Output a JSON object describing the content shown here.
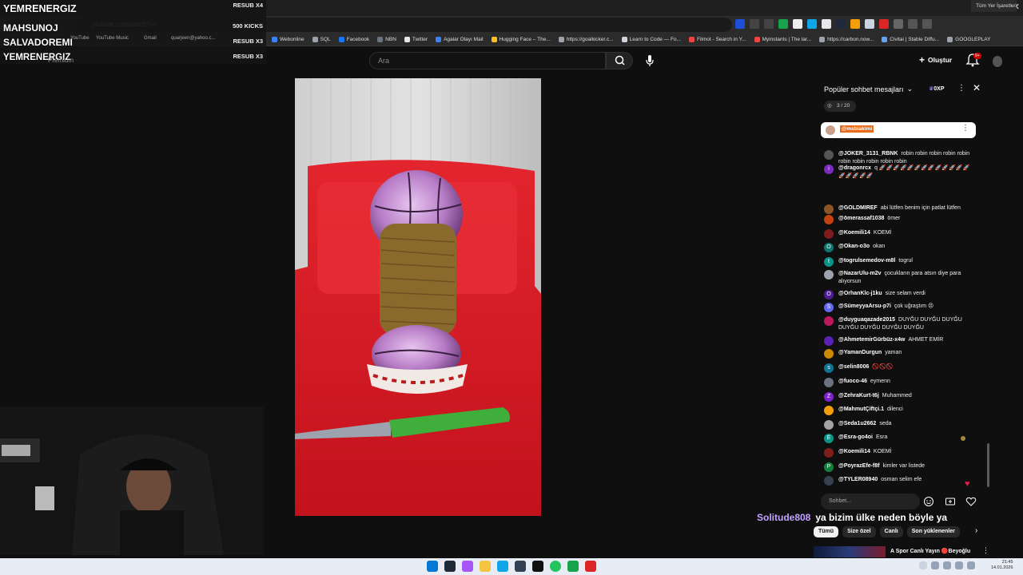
{
  "browser": {
    "url": "youtube.com/watch?v=...",
    "bookmarks": [
      {
        "label": "Webonline",
        "color": "#3b82f6"
      },
      {
        "label": "SQL",
        "color": "#9ca3af"
      },
      {
        "label": "Facebook",
        "color": "#1877f2"
      },
      {
        "label": "NBN",
        "color": "#6b7280"
      },
      {
        "label": "Twitter",
        "color": "#e5e7eb"
      },
      {
        "label": "Agalar Olayı Mail",
        "color": "#3b82f6"
      },
      {
        "label": "Hugging Face – The...",
        "color": "#fbbf24"
      },
      {
        "label": "https://goalkicker.c...",
        "color": "#9ca3af"
      },
      {
        "label": "Learn to Code — Fo...",
        "color": "#d1d5db"
      },
      {
        "label": "Filmot - Search in Y...",
        "color": "#ef4444"
      },
      {
        "label": "Myinstants | The lar...",
        "color": "#ef4444"
      },
      {
        "label": "https://carbon.now...",
        "color": "#9ca3af"
      },
      {
        "label": "Civitai | Stable Diffu...",
        "color": "#60a5fa"
      },
      {
        "label": "GOOGLEPLAY",
        "color": "#9ca3af"
      }
    ],
    "other_bookmarks": "Tüm Yer İşaretleri"
  },
  "youtube": {
    "search_placeholder": "Ara",
    "create_label": "Oluştur",
    "notifications_badge": "9+"
  },
  "overlay": {
    "names": [
      "YEMRENERGIZ",
      "MAHSUNOJ",
      "SALVADOREMI",
      "YEMRENERGIZ"
    ],
    "resubs": [
      "RESUB X4",
      "500 KICKS",
      "RESUB X3",
      "RESUB X3"
    ],
    "faded_bookmarks": [
      "YouTube",
      "YouTube Music",
      "Gmail",
      "quarjeen@yahoo.c...",
      "Premium"
    ]
  },
  "chat": {
    "title": "Popüler sohbet mesajları",
    "xp": "0XP",
    "progress": "3 / 20",
    "pinned_user": "@msbiakimi",
    "input_placeholder": "Sohbet...",
    "messages": [
      {
        "user": "@JOKER_3131_RBNK",
        "text": "robin robin robin robin robin robin robin robin robin robin",
        "avatar_color": "#555555",
        "initial": ""
      },
      {
        "user": "@dragonrcx",
        "text": "q 🚀🚀🚀🚀🚀🚀🚀🚀🚀🚀🚀🚀🚀🚀🚀🚀🚀🚀",
        "avatar_color": "#7b2cbf",
        "initial": "i"
      },
      {
        "user": "@GOLDMIREF",
        "text": "abi lütfen benim için patlat lütfen",
        "avatar_color": "#8d5524",
        "initial": ""
      },
      {
        "user": "@ömerassaf1038",
        "text": "ömer",
        "avatar_color": "#c2410c",
        "initial": ""
      },
      {
        "user": "@Koemili14",
        "text": "KOEMİ",
        "avatar_color": "#7f1d1d",
        "initial": ""
      },
      {
        "user": "@Okan-o3o",
        "text": "okan",
        "avatar_color": "#0f766e",
        "initial": "O"
      },
      {
        "user": "@togrulsemedov-m8l",
        "text": "togrul",
        "avatar_color": "#0d9488",
        "initial": "t"
      },
      {
        "user": "@NazarUlu-m2v",
        "text": "çocukların para atsın diye para alıyorsun",
        "avatar_color": "#9ca3af",
        "initial": ""
      },
      {
        "user": "@OrhanKlc-j1ku",
        "text": "size selam verdi",
        "avatar_color": "#4c1d95",
        "initial": "O"
      },
      {
        "user": "@SümeyyaArsu-p7i",
        "text": "çok uğraştım 😣",
        "avatar_color": "#6366f1",
        "initial": "S"
      },
      {
        "user": "@duyguaqazade2015",
        "text": "DUYĞU DUYĞU DUYĞU DUYĞU DUYĞU DUYĞU DUYĞU",
        "avatar_color": "#be185d",
        "initial": ""
      },
      {
        "user": "@AhmetemirGürbüz-x4w",
        "text": "AHMET EMİR",
        "avatar_color": "#5b21b6",
        "initial": ""
      },
      {
        "user": "@YamanDurgun",
        "text": "yaman",
        "avatar_color": "#ca8a04",
        "initial": ""
      },
      {
        "user": "@selin8006",
        "text": "🚫🚫🚫",
        "avatar_color": "#0e7490",
        "initial": "s"
      },
      {
        "user": "@fuoco-46",
        "text": "eymenn",
        "avatar_color": "#6b7280",
        "initial": ""
      },
      {
        "user": "@ZehraKurt-t6j",
        "text": "Muhammed",
        "avatar_color": "#7e22ce",
        "initial": "Z"
      },
      {
        "user": "@MahmutÇiftçi.1",
        "text": "dilenci",
        "avatar_color": "#f59e0b",
        "initial": ""
      },
      {
        "user": "@Seda1u2662",
        "text": "seda",
        "avatar_color": "#a3a3a3",
        "initial": ""
      },
      {
        "user": "@Esra-go4oi",
        "text": "Esra",
        "avatar_color": "#0d9488",
        "initial": "E"
      },
      {
        "user": "@Koemili14",
        "text": "KOEMİ",
        "avatar_color": "#7f1d1d",
        "initial": ""
      },
      {
        "user": "@PoyrazEfe-f8f",
        "text": "kimler var listede",
        "avatar_color": "#15803d",
        "initial": "P"
      },
      {
        "user": "@TYLER08940",
        "text": "osman selim efe",
        "avatar_color": "#374151",
        "initial": ""
      }
    ]
  },
  "caption": {
    "user": "Solitude808",
    "text": "ya bizim ülke neden böyle ya"
  },
  "chips": [
    "Tümü",
    "Size özel",
    "Canlı",
    "Son yüklenenler"
  ],
  "next_video": {
    "title": "A Spor Canlı Yayın 🔴Beyoğlu"
  },
  "taskbar": {
    "time": "21:45",
    "date": "14.01.2026"
  }
}
